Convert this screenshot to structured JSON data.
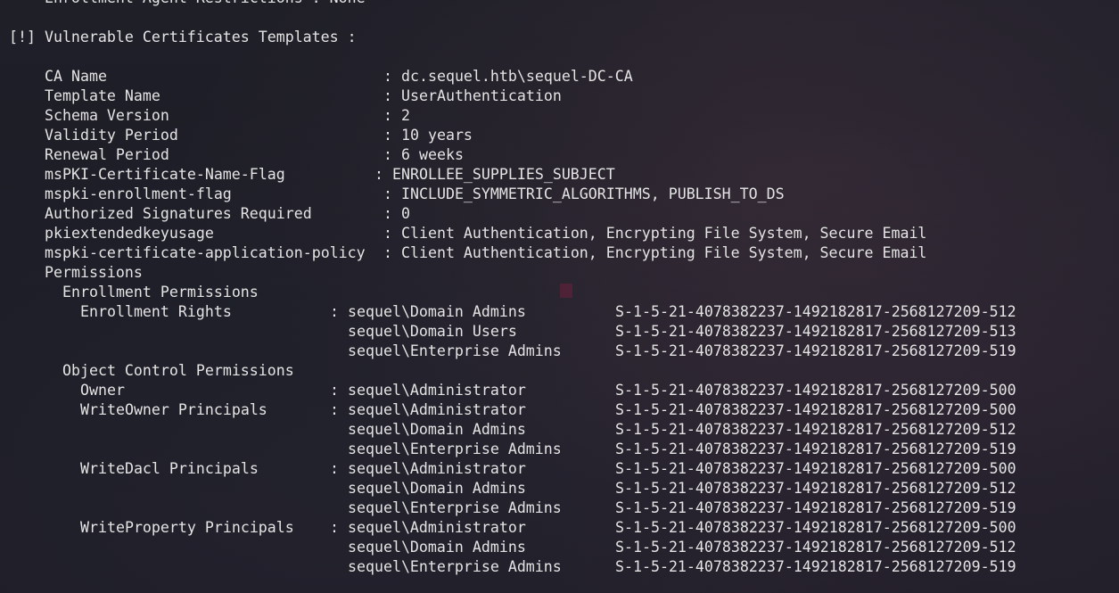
{
  "prev_line": "    Enrollment Agent Restrictions : None",
  "section_header": "[!] Vulnerable Certificates Templates :",
  "fields": [
    {
      "key": "CA Name",
      "sep": ": ",
      "value": "dc.sequel.htb\\sequel-DC-CA"
    },
    {
      "key": "Template Name",
      "sep": ": ",
      "value": "UserAuthentication"
    },
    {
      "key": "Schema Version",
      "sep": ": ",
      "value": "2"
    },
    {
      "key": "Validity Period",
      "sep": ": ",
      "value": "10 years"
    },
    {
      "key": "Renewal Period",
      "sep": ": ",
      "value": "6 weeks"
    },
    {
      "key": "msPKI-Certificate-Name-Flag",
      "sep": ": ",
      "value": "ENROLLEE_SUPPLIES_SUBJECT"
    },
    {
      "key": "mspki-enrollment-flag",
      "sep": ": ",
      "value": "INCLUDE_SYMMETRIC_ALGORITHMS, PUBLISH_TO_DS"
    },
    {
      "key": "Authorized Signatures Required",
      "sep": ": ",
      "value": "0"
    },
    {
      "key": "pkiextendedkeyusage",
      "sep": ": ",
      "value": "Client Authentication, Encrypting File System, Secure Email"
    },
    {
      "key": "mspki-certificate-application-policy",
      "sep": ": ",
      "value": "Client Authentication, Encrypting File System, Secure Email"
    }
  ],
  "permissions": {
    "label": "Permissions",
    "enrollment": {
      "label": "Enrollment Permissions",
      "rights_label": "Enrollment Rights",
      "entries": [
        {
          "principal": "sequel\\Domain Admins",
          "sid": "S-1-5-21-4078382237-1492182817-2568127209-512"
        },
        {
          "principal": "sequel\\Domain Users",
          "sid": "S-1-5-21-4078382237-1492182817-2568127209-513"
        },
        {
          "principal": "sequel\\Enterprise Admins",
          "sid": "S-1-5-21-4078382237-1492182817-2568127209-519"
        }
      ]
    },
    "object_control": {
      "label": "Object Control Permissions",
      "groups": [
        {
          "label": "Owner",
          "entries": [
            {
              "principal": "sequel\\Administrator",
              "sid": "S-1-5-21-4078382237-1492182817-2568127209-500"
            }
          ]
        },
        {
          "label": "WriteOwner Principals",
          "entries": [
            {
              "principal": "sequel\\Administrator",
              "sid": "S-1-5-21-4078382237-1492182817-2568127209-500"
            },
            {
              "principal": "sequel\\Domain Admins",
              "sid": "S-1-5-21-4078382237-1492182817-2568127209-512"
            },
            {
              "principal": "sequel\\Enterprise Admins",
              "sid": "S-1-5-21-4078382237-1492182817-2568127209-519"
            }
          ]
        },
        {
          "label": "WriteDacl Principals",
          "entries": [
            {
              "principal": "sequel\\Administrator",
              "sid": "S-1-5-21-4078382237-1492182817-2568127209-500"
            },
            {
              "principal": "sequel\\Domain Admins",
              "sid": "S-1-5-21-4078382237-1492182817-2568127209-512"
            },
            {
              "principal": "sequel\\Enterprise Admins",
              "sid": "S-1-5-21-4078382237-1492182817-2568127209-519"
            }
          ]
        },
        {
          "label": "WriteProperty Principals",
          "entries": [
            {
              "principal": "sequel\\Administrator",
              "sid": "S-1-5-21-4078382237-1492182817-2568127209-500"
            },
            {
              "principal": "sequel\\Domain Admins",
              "sid": "S-1-5-21-4078382237-1492182817-2568127209-512"
            },
            {
              "principal": "sequel\\Enterprise Admins",
              "sid": "S-1-5-21-4078382237-1492182817-2568127209-519"
            }
          ]
        }
      ]
    }
  },
  "theme": {
    "background": "#1d1e27",
    "foreground": "#e4e4e4"
  }
}
